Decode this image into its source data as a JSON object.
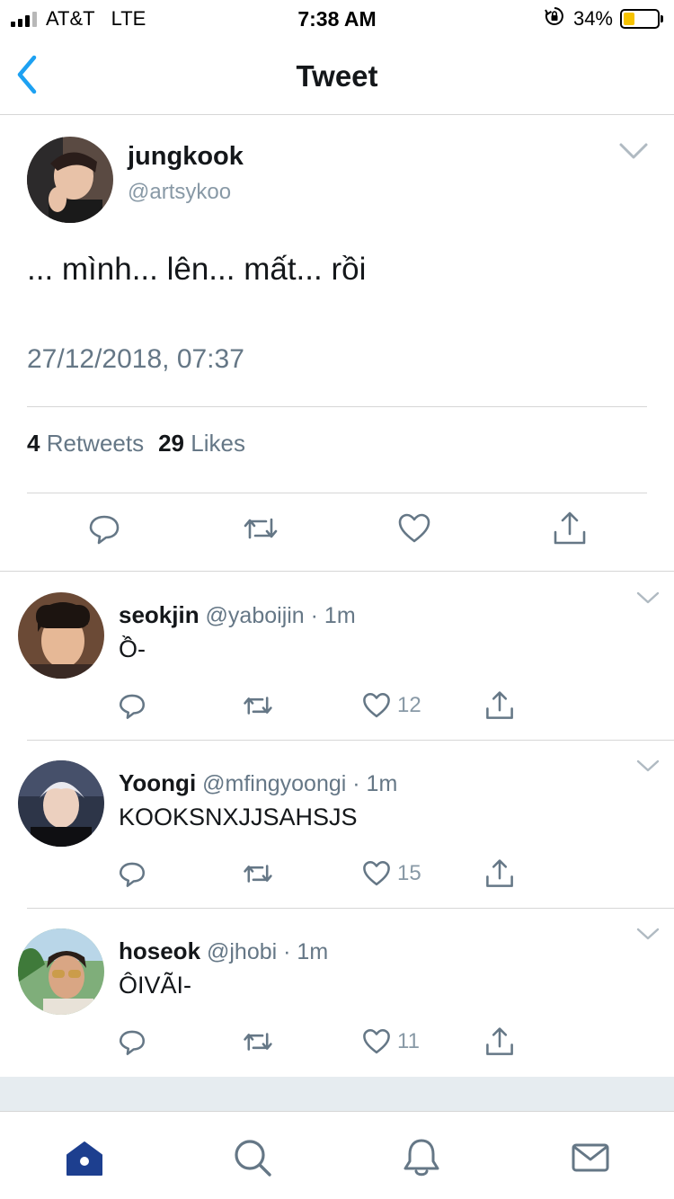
{
  "status_bar": {
    "carrier": "AT&T",
    "network": "LTE",
    "time": "7:38 AM",
    "battery": "34%",
    "battery_level": 0.34,
    "battery_color": "#f6c300"
  },
  "nav": {
    "title": "Tweet",
    "back_icon": "chevron-left-icon",
    "accent": "#1da1f2"
  },
  "tweet": {
    "name": "jungkook",
    "handle": "@artsykoo",
    "text": "... mình... lên... mất... rồi",
    "timestamp": "27/12/2018, 07:37",
    "retweets_count": "4",
    "retweets_label": "Retweets",
    "likes_count": "29",
    "likes_label": "Likes",
    "actions": [
      "reply-icon",
      "retweet-icon",
      "like-icon",
      "share-icon"
    ]
  },
  "replies": [
    {
      "name": "seokjin",
      "handle": "@yaboijin",
      "time": "· 1m",
      "text": "Ồ-",
      "likes": "12"
    },
    {
      "name": "Yoongi",
      "handle": "@mfingyoongi",
      "time": "· 1m",
      "text": "KOOKSNXJJSAHSJS",
      "likes": "15"
    },
    {
      "name": "hoseok",
      "handle": "@jhobi",
      "time": "· 1m",
      "text": "ÔIVÃI-",
      "likes": "11"
    }
  ],
  "tab_bar": {
    "tabs": [
      "home-icon",
      "search-icon",
      "notifications-icon",
      "messages-icon"
    ],
    "active_color": "#1d3f8f",
    "inactive_color": "#657786"
  }
}
